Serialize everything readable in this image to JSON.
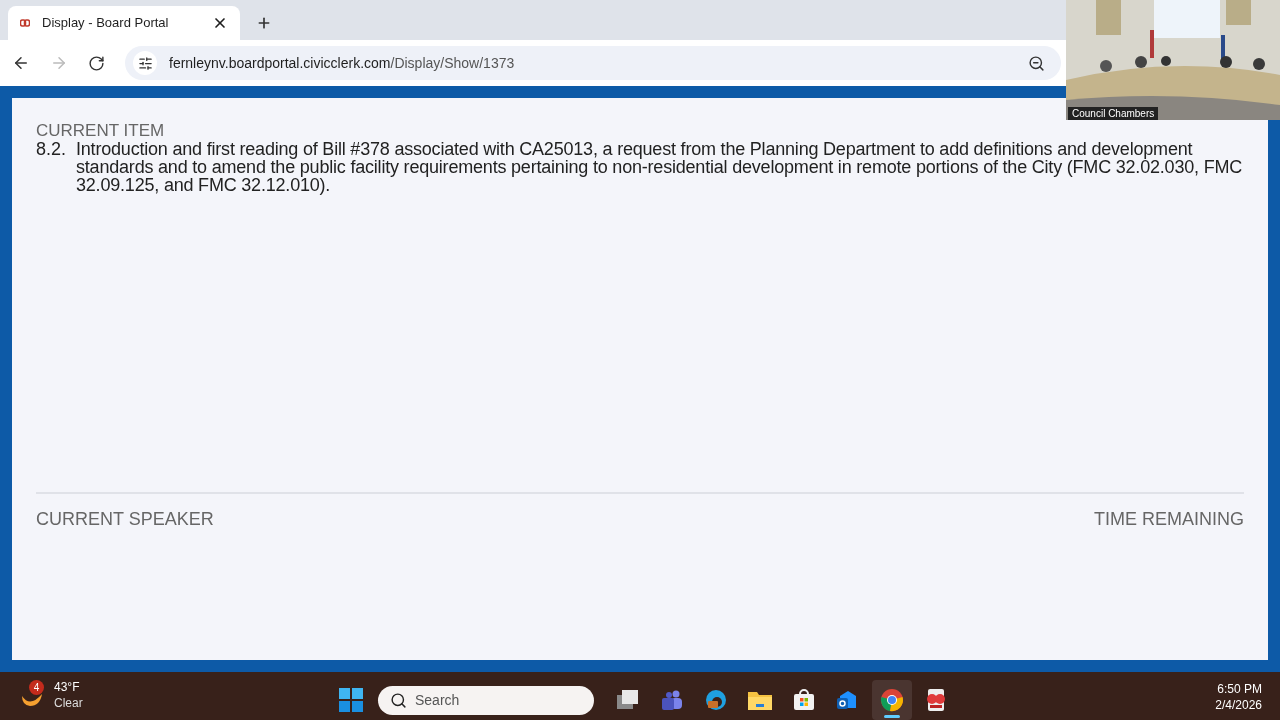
{
  "browser": {
    "tab": {
      "title": "Display - Board Portal",
      "selected": true
    },
    "url_host": "fernleynv.boardportal.civicclerk.com",
    "url_path": "/Display/Show/1373",
    "forward_disabled": true
  },
  "video": {
    "label": "Council Chambers"
  },
  "page": {
    "current_item_label": "CURRENT ITEM",
    "item_number": "8.2.",
    "item_text": "Introduction and first reading of Bill #378 associated with CA25013, a request from the Planning Department to add definitions and development standards and to amend the public facility requirements pertaining to non-residential development in remote portions of the City (FMC 32.02.030, FMC 32.09.125, and FMC 32.12.010).",
    "current_speaker_label": "CURRENT SPEAKER",
    "time_remaining_label": "TIME REMAINING"
  },
  "taskbar": {
    "weather": {
      "badge": "4",
      "temperature": "43°F",
      "condition": "Clear"
    },
    "search_placeholder": "Search",
    "apps": [
      {
        "kind": "taskview",
        "active": false
      },
      {
        "kind": "teams",
        "active": false
      },
      {
        "kind": "edge",
        "active": false
      },
      {
        "kind": "files",
        "active": false
      },
      {
        "kind": "store",
        "active": false
      },
      {
        "kind": "outlook",
        "active": false
      },
      {
        "kind": "chrome",
        "active": true
      },
      {
        "kind": "media",
        "active": false
      }
    ],
    "time": "6:50 PM",
    "date": "2/4/2026"
  }
}
